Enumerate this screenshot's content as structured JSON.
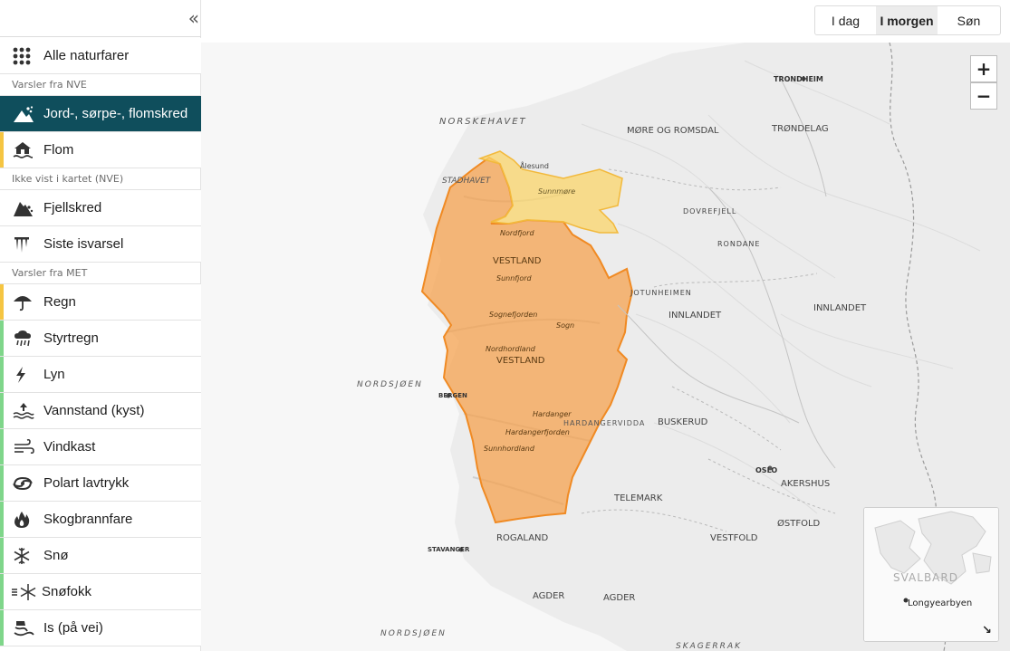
{
  "sidebar": {
    "collapse_glyph": "«",
    "all_hazards": "Alle naturfarer",
    "sections": {
      "nve": "Varsler fra NVE",
      "not_in_map": "Ikke vist i kartet (NVE)",
      "met": "Varsler fra MET"
    },
    "items": [
      {
        "label": "Jord-, sørpe-, flomskred",
        "icon": "landslide-icon",
        "stripe": "#0f4e5c"
      },
      {
        "label": "Flom",
        "icon": "flood-house-icon",
        "stripe": "#f5c542"
      },
      {
        "label": "Fjellskred",
        "icon": "rockslide-icon",
        "stripe": ""
      },
      {
        "label": "Siste isvarsel",
        "icon": "icicle-icon",
        "stripe": ""
      },
      {
        "label": "Regn",
        "icon": "umbrella-icon",
        "stripe": "#f5c542"
      },
      {
        "label": "Styrtregn",
        "icon": "heavy-rain-icon",
        "stripe": "#7fd68a"
      },
      {
        "label": "Lyn",
        "icon": "lightning-icon",
        "stripe": "#7fd68a"
      },
      {
        "label": "Vannstand (kyst)",
        "icon": "water-level-icon",
        "stripe": "#7fd68a"
      },
      {
        "label": "Vindkast",
        "icon": "wind-icon",
        "stripe": "#7fd68a"
      },
      {
        "label": "Polart lavtrykk",
        "icon": "polar-low-icon",
        "stripe": "#7fd68a"
      },
      {
        "label": "Skogbrannfare",
        "icon": "fire-icon",
        "stripe": "#7fd68a"
      },
      {
        "label": "Snø",
        "icon": "snowflake-icon",
        "stripe": "#7fd68a"
      },
      {
        "label": "Snøfokk",
        "icon": "drifting-snow-icon",
        "stripe": "#7fd68a"
      },
      {
        "label": "Is (på vei)",
        "icon": "icy-road-icon",
        "stripe": "#7fd68a"
      }
    ]
  },
  "days": {
    "tabs": [
      "I dag",
      "I morgen",
      "Søn"
    ],
    "selected": "I morgen"
  },
  "map": {
    "zoom_in": "+",
    "zoom_out": "−",
    "warning_colors": {
      "orange": "#f5a04a",
      "yellow": "#fbd56b"
    },
    "labels": {
      "sea1": "NORSKEHAVET",
      "stadhavet": "STADHAVET",
      "nordsjoen": "NORDSJØEN",
      "nordsjoen2": "NORDSJØEN",
      "skagerrak": "SKAGERRAK",
      "more_romsdal": "MØRE OG ROMSDAL",
      "trondelag": "TRØNDELAG",
      "trondheim": "TRONDHEIM",
      "vestland1": "VESTLAND",
      "vestland2": "VESTLAND",
      "innlandet1": "INNLANDET",
      "innlandet2": "INNLANDET",
      "buskerud": "BUSKERUD",
      "telemark": "TELEMARK",
      "rogaland": "ROGALAND",
      "agder1": "AGDER",
      "agder2": "AGDER",
      "vestfold": "VESTFOLD",
      "ostfold": "ØSTFOLD",
      "akershus": "AKERSHUS",
      "oslo": "OSLO",
      "bergen": "BERGEN",
      "stavanger": "STAVANGER",
      "alesund": "Ålesund",
      "sunnmore": "Sunnmøre",
      "nordfjord": "Nordfjord",
      "sunnfjord": "Sunnfjord",
      "sogn": "Sogn",
      "sognefjorden": "Sognefjorden",
      "nordhordland": "Nordhordland",
      "hardanger": "Hardanger",
      "hardangerfjorden": "Hardangerfjorden",
      "sunnhordland": "Sunnhordland",
      "jotunheimen": "JOTUNHEIMEN",
      "dovrefjell": "DOVREFJELL",
      "rondane": "RONDANE",
      "hardangervidda": "HARDANGERVIDDA"
    },
    "inset": {
      "title": "SVALBARD",
      "city": "Longyearbyen",
      "expand_glyph": "↘"
    }
  }
}
